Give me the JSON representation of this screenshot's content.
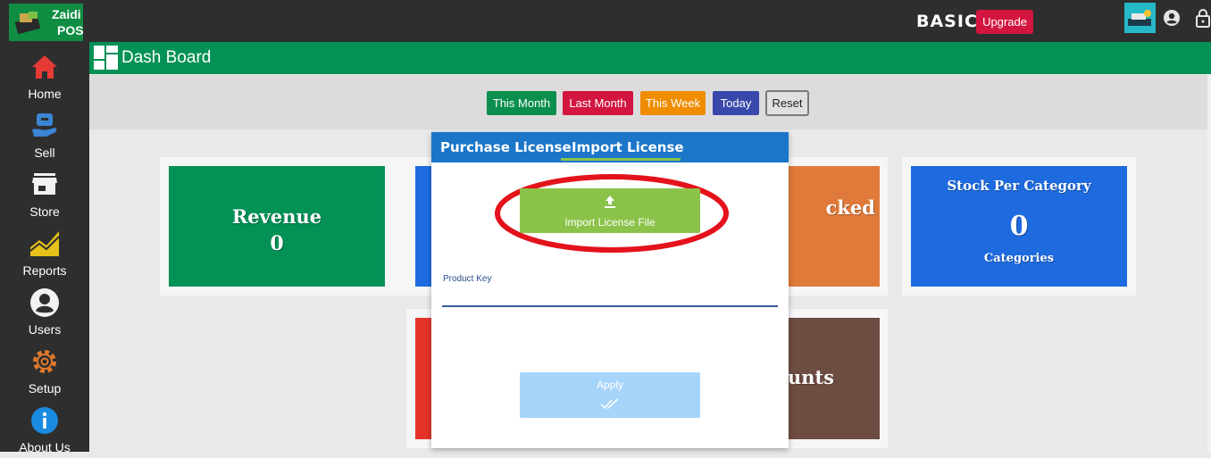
{
  "app": {
    "logo_line1": "Zaidi",
    "logo_line2": "POS",
    "plan": "BASIC",
    "upgrade_label": "Upgrade"
  },
  "colors": {
    "sidebar_bg": "#2e2e2e",
    "header_green": "#039156",
    "modal_tab_blue": "#1b76c9",
    "import_green": "#8bc34a",
    "apply_disabled": "#a6d4fa",
    "upgrade_red": "#d3163f"
  },
  "sidebar": {
    "items": [
      {
        "label": "Home",
        "icon": "home-icon"
      },
      {
        "label": "Sell",
        "icon": "sell-icon"
      },
      {
        "label": "Store",
        "icon": "store-icon"
      },
      {
        "label": "Reports",
        "icon": "reports-icon"
      },
      {
        "label": "Users",
        "icon": "users-icon"
      },
      {
        "label": "Setup",
        "icon": "gear-icon"
      },
      {
        "label": "About Us",
        "icon": "info-icon"
      }
    ]
  },
  "header": {
    "title": "Dash Board"
  },
  "filters": [
    {
      "label": "This Month",
      "color": "#0b8f4e"
    },
    {
      "label": "Last Month",
      "color": "#d3163f"
    },
    {
      "label": "This Week",
      "color": "#f08c00"
    },
    {
      "label": "Today",
      "color": "#3949ab"
    },
    {
      "label": "Reset",
      "color": "#e0e0e0"
    }
  ],
  "cards": {
    "revenue": {
      "title": "Revenue",
      "value": "0",
      "color": "#039156"
    },
    "card2": {
      "color": "#1e6be0"
    },
    "card3": {
      "title_fragment": "cked",
      "color": "#e07a3a"
    },
    "stock": {
      "title": "Stock Per Category",
      "value": "0",
      "sub": "Categories",
      "color": "#1e6be0"
    },
    "card5": {
      "color": "#e5332a"
    },
    "card6": {
      "title_fragment": "unts",
      "color": "#6d4c41"
    }
  },
  "modal": {
    "tab_purchase": "Purchase License",
    "tab_import": "Import License",
    "import_button": "Import License File",
    "product_key_label": "Product Key",
    "product_key_value": "",
    "apply_label": "Apply"
  }
}
